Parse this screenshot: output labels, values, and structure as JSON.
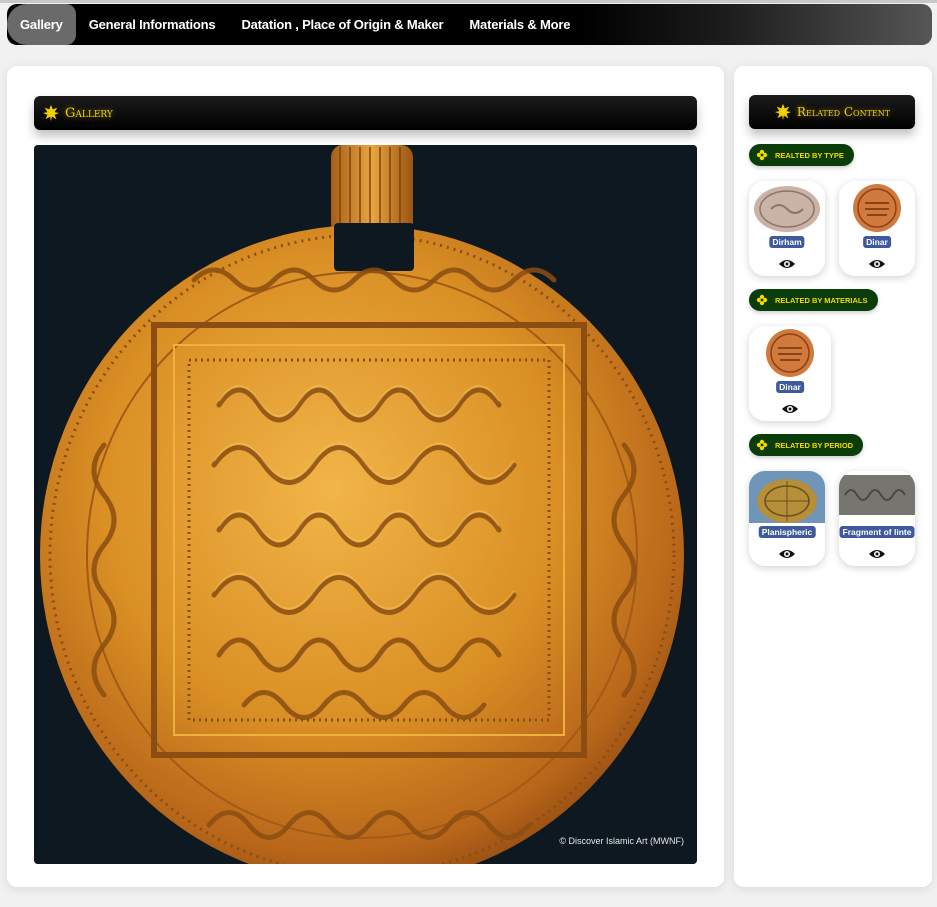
{
  "nav": {
    "tabs": [
      {
        "label": "Gallery",
        "active": true
      },
      {
        "label": "General Informations",
        "active": false
      },
      {
        "label": "Datation , Place of Origin & Maker",
        "active": false
      },
      {
        "label": "Materials & More",
        "active": false
      }
    ]
  },
  "gallery": {
    "title": "Gallery",
    "copyright": "© Discover Islamic Art (MWNF)"
  },
  "related": {
    "title": "Related Content",
    "groups": [
      {
        "label": "REALTED BY TYPE",
        "items": [
          "Dirham",
          "Dinar"
        ]
      },
      {
        "label": "RELATED BY MATERIALS",
        "items": [
          "Dinar"
        ]
      },
      {
        "label": "RELATED BY PERIOD",
        "items": [
          "Planispheric",
          "Fragment of linte"
        ]
      }
    ]
  },
  "colors": {
    "accent_gold": "#f2d000",
    "pill_green": "#0b3d0b",
    "label_blue": "#3e5a9c"
  },
  "icons": [
    "leaf-icon",
    "flower-icon",
    "eye-icon"
  ]
}
